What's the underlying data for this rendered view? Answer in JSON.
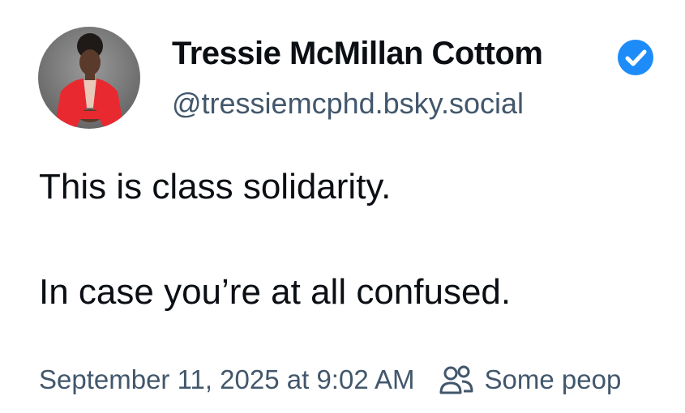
{
  "author": {
    "display_name": "Tressie McMillan Cottom",
    "handle": "@tressiemcphd.bsky.social",
    "verified_icon": "verified-check-icon",
    "avatar_icon": "avatar"
  },
  "post": {
    "line1": "This is class solidarity.",
    "line2": "In case you’re at all confused."
  },
  "meta": {
    "timestamp": "September 11, 2025 at 9:02 AM",
    "audience_icon": "people-icon",
    "audience_label": "Some peop"
  },
  "colors": {
    "text_primary": "#0b0f14",
    "text_secondary": "#42576c",
    "verified_blue": "#1d8cf8",
    "jacket_red": "#e8292f"
  }
}
